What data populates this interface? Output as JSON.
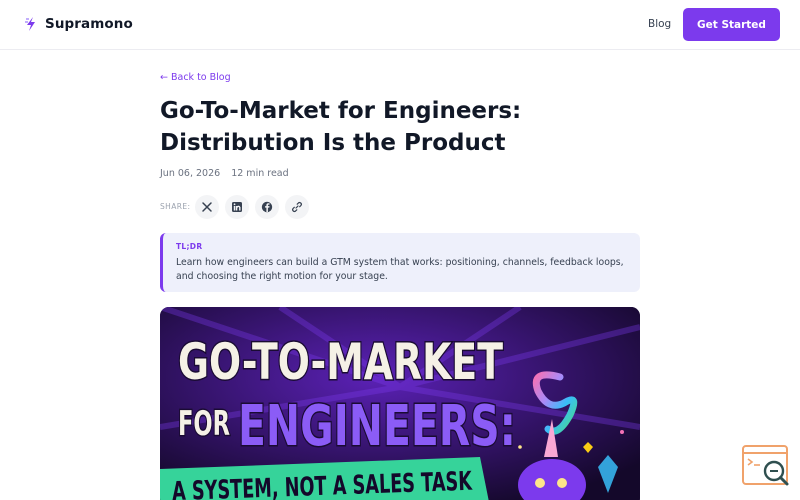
{
  "header": {
    "brand": "Supramono",
    "nav_blog": "Blog",
    "cta": "Get Started",
    "logo_icon": "spark-logo-icon"
  },
  "article": {
    "back_link": "← Back to Blog",
    "title": "Go-To-Market for Engineers: Distribution Is the Product",
    "date": "Jun 06, 2026",
    "read_time": "12 min read",
    "share_label": "SHARE:",
    "share_icons": [
      "x-icon",
      "linkedin-icon",
      "facebook-icon",
      "link-icon"
    ],
    "tldr_label": "TL;DR",
    "tldr_text": "Learn how engineers can build a GTM system that works: positioning, channels, feedback loops, and choosing the right motion for your stage."
  },
  "hero": {
    "line1": "GO-TO-MARKET",
    "line2a": "FOR",
    "line2b": "ENGINEERS:",
    "line3": "A SYSTEM, NOT A SALES TASK"
  },
  "widget": {
    "icon": "search-chat-icon"
  },
  "colors": {
    "accent": "#7c3aed",
    "tldr_bg": "#eef0fb",
    "hero_bg": "#1d0d3a",
    "hero_green": "#36d39a"
  }
}
